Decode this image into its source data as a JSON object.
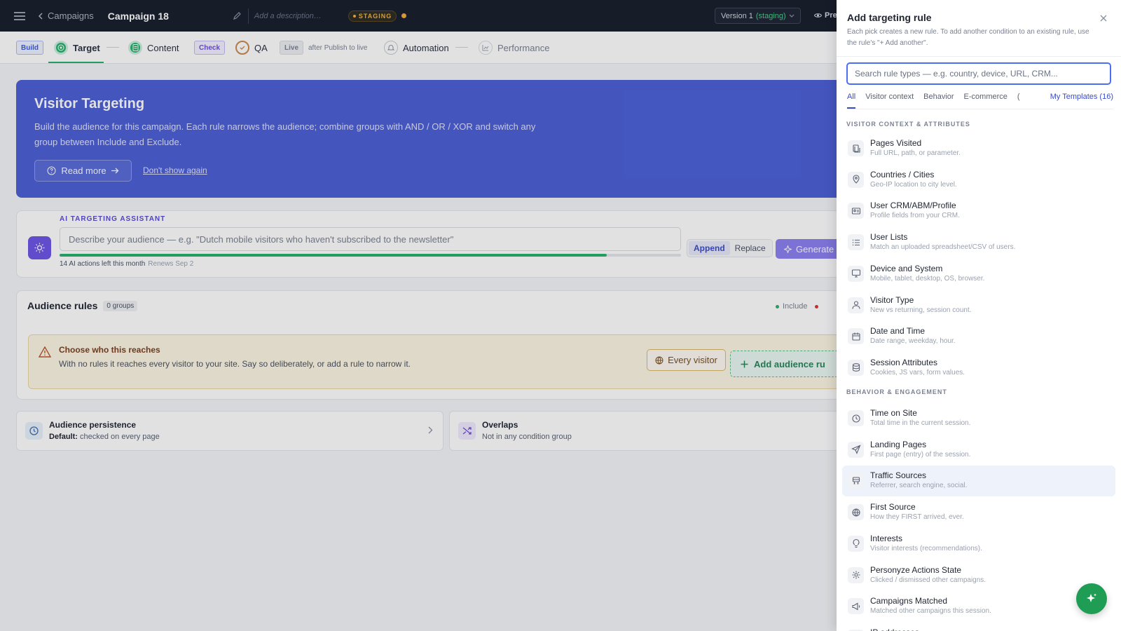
{
  "topbar": {
    "breadcrumb": "Campaigns",
    "campaign_title": "Campaign 18",
    "description_placeholder": "Add a description…",
    "staging_label": "STAGING",
    "version_label": "Version 1",
    "version_state": "(staging)",
    "preview_label": "Pre"
  },
  "steps": {
    "build_label": "Build",
    "target_label": "Target",
    "content_label": "Content",
    "check_label": "Check",
    "qa_label": "QA",
    "live_label": "Live",
    "after_publish": "after Publish to live",
    "automation_label": "Automation",
    "performance_label": "Performance"
  },
  "hero": {
    "title": "Visitor Targeting",
    "text": "Build the audience for this campaign. Each rule narrows the audience; combine groups with AND / OR / XOR and switch any group between Include and Exclude.",
    "read_more": "Read more",
    "dont_show": "Don't show again"
  },
  "ai": {
    "label": "AI TARGETING ASSISTANT",
    "placeholder": "Describe your audience — e.g. \"Dutch mobile visitors who haven't subscribed to the newsletter\"",
    "actions_left": "14 AI actions left this month",
    "renews": "Renews Sep 2",
    "progress_fraction": 0.88,
    "append": "Append",
    "replace": "Replace",
    "generate": "Generate"
  },
  "audience": {
    "title": "Audience rules",
    "groups_badge": "0 groups",
    "include_label": "Include",
    "warn_title": "Choose who this reaches",
    "warn_text": "With no rules it reaches every visitor to your site. Say so deliberately, or add a rule to narrow it.",
    "every_visitor": "Every visitor",
    "add_rule": "Add audience ru"
  },
  "persistence": {
    "title": "Audience persistence",
    "default_label": "Default:",
    "default_value": "checked on every page"
  },
  "overlaps": {
    "title": "Overlaps",
    "subtitle": "Not in any condition group"
  },
  "panel": {
    "title": "Add targeting rule",
    "subtitle": "Each pick creates a new rule. To add another condition to an existing rule, use the rule's \"+ Add another\".",
    "search_placeholder": "Search rule types — e.g. country, device, URL, CRM...",
    "tabs": [
      "All",
      "Visitor context",
      "Behavior",
      "E-commerce",
      "("
    ],
    "my_templates": "My Templates (16)",
    "section1": "VISITOR CONTEXT & ATTRIBUTES",
    "section2": "BEHAVIOR & ENGAGEMENT",
    "items1": [
      {
        "title": "Pages Visited",
        "sub": "Full URL, path, or parameter.",
        "icon": "pages-icon"
      },
      {
        "title": "Countries / Cities",
        "sub": "Geo-IP location to city level.",
        "icon": "location-pin-icon"
      },
      {
        "title": "User CRM/ABM/Profile",
        "sub": "Profile fields from your CRM.",
        "icon": "id-card-icon"
      },
      {
        "title": "User Lists",
        "sub": "Match an uploaded spreadsheet/CSV of users.",
        "icon": "list-icon"
      },
      {
        "title": "Device and System",
        "sub": "Mobile, tablet, desktop, OS, browser.",
        "icon": "monitor-icon"
      },
      {
        "title": "Visitor Type",
        "sub": "New vs returning, session count.",
        "icon": "user-icon"
      },
      {
        "title": "Date and Time",
        "sub": "Date range, weekday, hour.",
        "icon": "calendar-icon"
      },
      {
        "title": "Session Attributes",
        "sub": "Cookies, JS vars, form values.",
        "icon": "database-icon"
      }
    ],
    "items2": [
      {
        "title": "Time on Site",
        "sub": "Total time in the current session.",
        "icon": "clock-icon"
      },
      {
        "title": "Landing Pages",
        "sub": "First page (entry) of the session.",
        "icon": "send-icon"
      },
      {
        "title": "Traffic Sources",
        "sub": "Referrer, search engine, social.",
        "icon": "traffic-icon"
      },
      {
        "title": "First Source",
        "sub": "How they FIRST arrived, ever.",
        "icon": "globe-icon"
      },
      {
        "title": "Interests",
        "sub": "Visitor interests (recommendations).",
        "icon": "lightbulb-icon"
      },
      {
        "title": "Personyze Actions State",
        "sub": "Clicked / dismissed other campaigns.",
        "icon": "gear-icon"
      },
      {
        "title": "Campaigns Matched",
        "sub": "Matched other campaigns this session.",
        "icon": "megaphone-icon"
      },
      {
        "title": "IP addresses",
        "sub": "",
        "icon": "network-icon"
      }
    ]
  }
}
